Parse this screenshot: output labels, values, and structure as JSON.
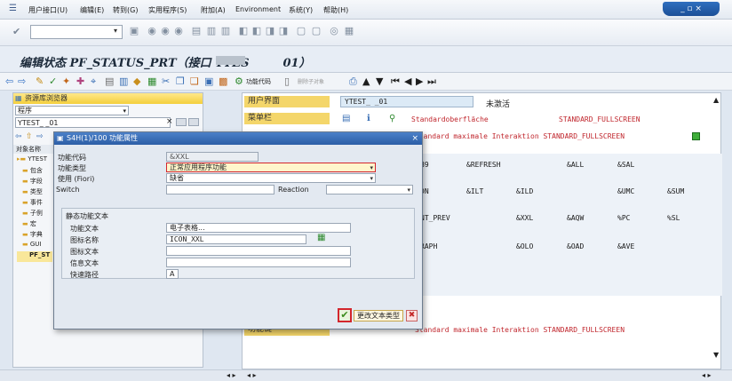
{
  "menu": [
    "用户接口(U)",
    "编辑(E)",
    "转到(G)",
    "实用程序(S)",
    "附加(A)",
    "Environment",
    "系统(Y)",
    "帮助(H)"
  ],
  "window_controls": "_ ▫ ×",
  "title": {
    "prefix": "编辑状态 PF_STATUS_PRT（接口 YTES",
    "suffix": "01）"
  },
  "app_toolbar": {
    "func_code": "功能代码",
    "delete_obj": "删除子对象"
  },
  "left_pane": {
    "header": "资源库浏览器",
    "program_label": "程序",
    "program_value": "YTEST_   _01",
    "object_name_label": "对象名称",
    "tree": [
      "YTEST",
      "包含",
      "字段",
      "类型",
      "事件",
      "子例",
      "宏",
      "字典",
      "GUI",
      "PF_ST"
    ]
  },
  "main": {
    "user_interface_label": "用户界面",
    "user_interface_value": "YTEST_   _01",
    "status": "未激活",
    "menubar_label": "菜单栏",
    "std_surface": "Standardoberfläche",
    "std_fullscreen": "STANDARD_FULLSCREEN",
    "std_max_interaction": "Standard maximale Interaktion STANDARD_FULLSCREEN",
    "func_key_label": "功能键",
    "grid": [
      [
        "B9",
        "&REFRESH",
        "",
        "&ALL",
        "&SAL",
        ""
      ],
      [
        "DN",
        "&ILT",
        "&ILD",
        "",
        "&UMC",
        "&SUM"
      ],
      [
        "NT_PREV",
        "",
        "&XXL",
        "&AQW",
        "%PC",
        "%SL"
      ],
      [
        "RAPH",
        "",
        "&OLO",
        "&OAD",
        "&AVE",
        ""
      ]
    ]
  },
  "dialog": {
    "title": "S4H(1)/100 功能属性",
    "func_code_label": "功能代码",
    "func_code_value": "&XXL",
    "func_type_label": "功能类型",
    "func_type_value": "正常应用程序功能",
    "fiori_label": "使用 (Fiori)",
    "fiori_value": "缺省",
    "switch_label": "Switch",
    "reaction_label": "Reaction",
    "static_section": "静态功能文本",
    "func_text_label": "功能文本",
    "func_text_value": "电子表格...",
    "icon_name_label": "图标名称",
    "icon_name_value": "ICON_XXL",
    "icon_text_label": "图标文本",
    "info_text_label": "信息文本",
    "shortcut_label": "快速路径",
    "shortcut_value": "A",
    "change_text_type": "更改文本类型"
  }
}
